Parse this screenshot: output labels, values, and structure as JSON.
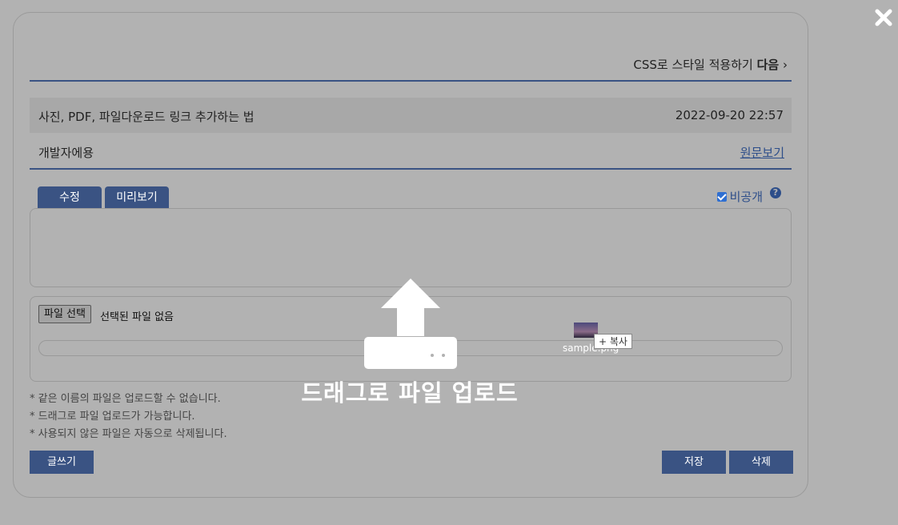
{
  "header": {
    "prev_post_text": "CSS로 스타일 적용하기",
    "next_label": "다음",
    "chevron": "›"
  },
  "post": {
    "title": "사진, PDF, 파일다운로드 링크 추가하는 법",
    "date": "2022-09-20 22:57",
    "category": "개발자에용",
    "view_original": "원문보기"
  },
  "editor": {
    "tabs": [
      {
        "label": "수정"
      },
      {
        "label": "미리보기"
      }
    ],
    "private_label": "비공개",
    "private_checked": true,
    "help_glyph": "?"
  },
  "upload": {
    "choose_file_label": "파일 선택",
    "no_file_text": "선택된 파일 없음",
    "progress": 0
  },
  "notes": [
    "* 같은 이름의 파일은 업로드할 수 없습니다.",
    "* 드래그로 파일 업로드가 가능합니다.",
    "* 사용되지 않은 파일은 자동으로 삭제됩니다."
  ],
  "actions": {
    "write_label": "글쓰기",
    "save_label": "저장",
    "delete_label": "삭제"
  },
  "drop_overlay": {
    "text": "드래그로 파일 업로드",
    "icon": "upload-tray-icon",
    "dragged_file_name": "sample.png",
    "copy_badge": "+ 복사"
  },
  "colors": {
    "accent": "#3a5383",
    "overlay_bg": "#b2b2b2",
    "link": "#2d4e8a"
  },
  "icons": {
    "close": "close-x-icon",
    "help": "question-circle-icon"
  }
}
